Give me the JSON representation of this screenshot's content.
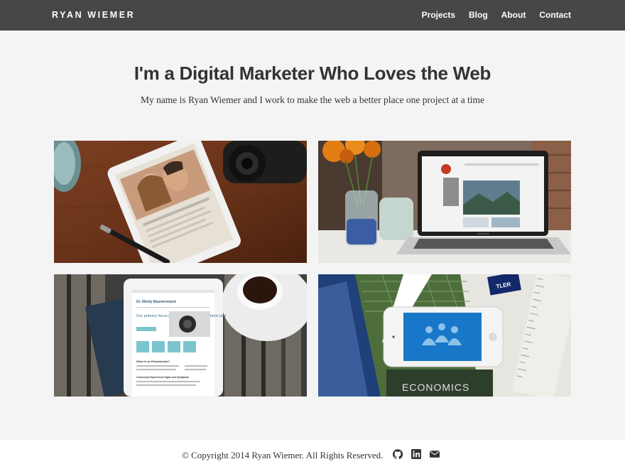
{
  "header": {
    "brand": "RYAN WIEMER",
    "nav": [
      {
        "label": "Projects"
      },
      {
        "label": "Blog"
      },
      {
        "label": "About"
      },
      {
        "label": "Contact"
      }
    ]
  },
  "hero": {
    "title": "I'm a Digital Marketer Who Loves the Web",
    "subtitle": "My name is Ryan Wiemer and I work to make the web a better place one project at a time"
  },
  "projects": [
    {
      "image": "ipad-on-wood-desk-with-camera"
    },
    {
      "image": "laptop-with-flowers"
    },
    {
      "image": "ipad-on-bench-with-coffee"
    },
    {
      "image": "iphone-on-desk-with-ruler"
    }
  ],
  "tile_texts": {
    "doctor_name": "Dr. Mindy Baumerstand",
    "doctor_focus": "Our primary focus is providing excellent patient care",
    "section_heading": "What is an Endodontist?",
    "footer_heading": "Commonly Experienced Signs and Symptoms",
    "tape_label": "TLER",
    "book_label": "ECONOMICS",
    "laptop_label": "MacBook"
  },
  "footer": {
    "copyright": "© Copyright 2014 Ryan Wiemer. All Rights Reserved.",
    "icons": [
      "github-icon",
      "linkedin-icon",
      "envelope-icon"
    ]
  },
  "colors": {
    "header_bg": "#474747",
    "page_bg": "#f4f4f4",
    "footer_bg": "#ffffff",
    "text": "#333333"
  }
}
